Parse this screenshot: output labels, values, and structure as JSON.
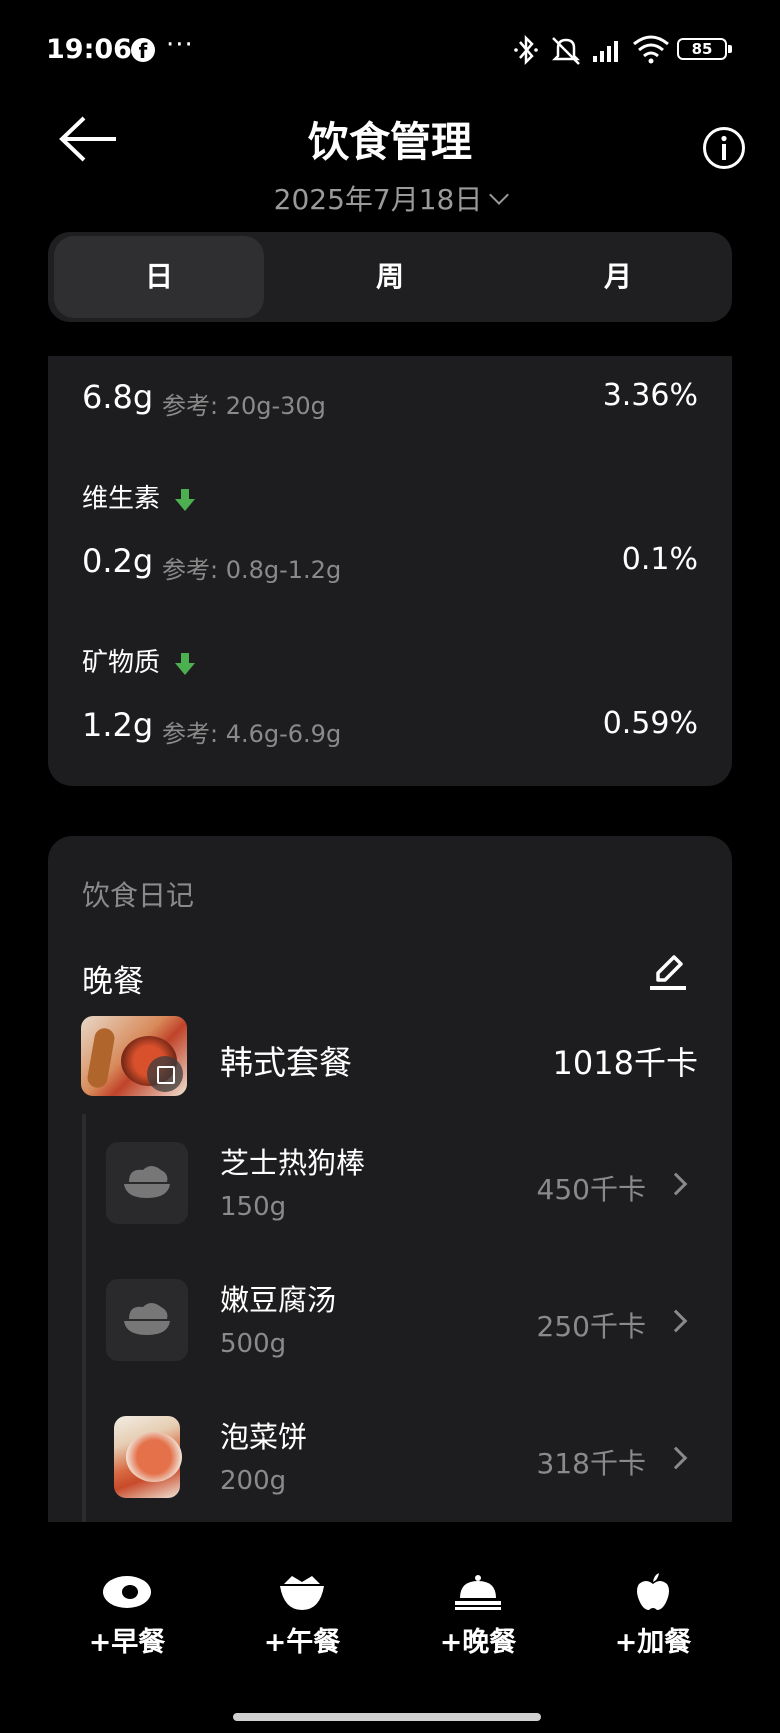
{
  "status_bar": {
    "time": "19:06",
    "facebook_glyph": "f",
    "more": "···",
    "battery": "85"
  },
  "header": {
    "title": "饮食管理",
    "date": "2025年7月18日"
  },
  "tabs": [
    {
      "label": "日",
      "active": true
    },
    {
      "label": "周",
      "active": false
    },
    {
      "label": "月",
      "active": false
    }
  ],
  "nutrients": {
    "top_row": {
      "amount": "6.8g",
      "reference": "参考: 20g-30g",
      "percent": "3.36%"
    },
    "vitamin": {
      "label": "维生素",
      "amount": "0.2g",
      "reference": "参考: 0.8g-1.2g",
      "percent": "0.1%",
      "trend": "down"
    },
    "mineral": {
      "label": "矿物质",
      "amount": "1.2g",
      "reference": "参考: 4.6g-6.9g",
      "percent": "0.59%",
      "trend": "down"
    }
  },
  "diary": {
    "title": "饮食日记",
    "meal": "晚餐",
    "set": {
      "name": "韩式套餐",
      "kcal": "1018千卡"
    },
    "items": [
      {
        "name": "芝士热狗棒",
        "weight": "150g",
        "kcal": "450千卡"
      },
      {
        "name": "嫩豆腐汤",
        "weight": "500g",
        "kcal": "250千卡"
      },
      {
        "name": "泡菜饼",
        "weight": "200g",
        "kcal": "318千卡"
      }
    ]
  },
  "bottom_actions": {
    "breakfast": "+早餐",
    "lunch": "+午餐",
    "dinner": "+晚餐",
    "snack": "+加餐"
  },
  "colors": {
    "background": "#000000",
    "card": "#1d1d1f",
    "muted_text": "#8a8a8a",
    "trend_down": "#4caf50"
  }
}
